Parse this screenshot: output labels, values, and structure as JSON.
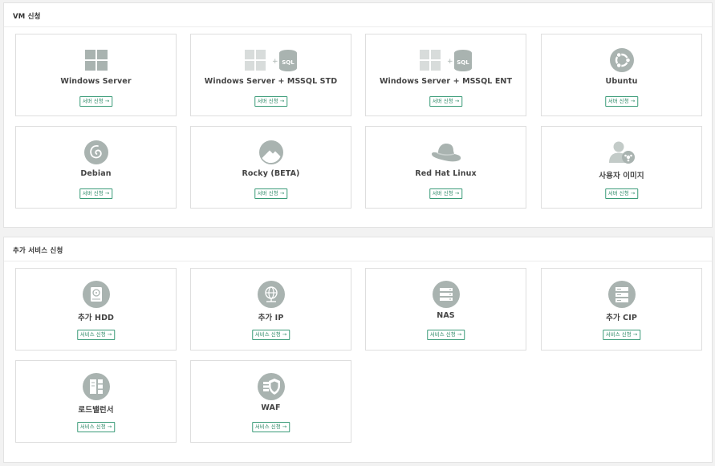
{
  "vm_section": {
    "title": "VM 신청",
    "cards": [
      {
        "title": "Windows Server",
        "button": "서버 신청 →",
        "icon": "windows-icon"
      },
      {
        "title": "Windows Server + MSSQL STD",
        "button": "서버 신청 →",
        "icon": "windows-sql-icon"
      },
      {
        "title": "Windows Server + MSSQL ENT",
        "button": "서버 신청 →",
        "icon": "windows-sql-icon"
      },
      {
        "title": "Ubuntu",
        "button": "서버 신청 →",
        "icon": "ubuntu-icon"
      },
      {
        "title": "Debian",
        "button": "서버 신청 →",
        "icon": "debian-icon"
      },
      {
        "title": "Rocky (BETA)",
        "button": "서버 신청 →",
        "icon": "rocky-icon"
      },
      {
        "title": "Red Hat Linux",
        "button": "서버 신청 →",
        "icon": "redhat-icon"
      },
      {
        "title": "사용자 이미지",
        "button": "서버 신청 →",
        "icon": "user-image-icon"
      }
    ]
  },
  "add_section": {
    "title": "추가 서비스 신청",
    "cards": [
      {
        "title": "추가 HDD",
        "button": "서비스 신청 →",
        "icon": "hdd-icon"
      },
      {
        "title": "추가 IP",
        "button": "서비스 신청 →",
        "icon": "globe-icon"
      },
      {
        "title": "NAS",
        "button": "서비스 신청 →",
        "icon": "nas-icon"
      },
      {
        "title": "추가 CIP",
        "button": "서비스 신청 →",
        "icon": "server-rack-icon"
      },
      {
        "title": "로드밸런서",
        "button": "서비스 신청 →",
        "icon": "load-balancer-icon"
      },
      {
        "title": "WAF",
        "button": "서비스 신청 →",
        "icon": "waf-shield-icon"
      }
    ]
  },
  "colors": {
    "icon_gray": "#a9b3b0",
    "accent_green": "#3a9b78",
    "border": "#dedede"
  }
}
